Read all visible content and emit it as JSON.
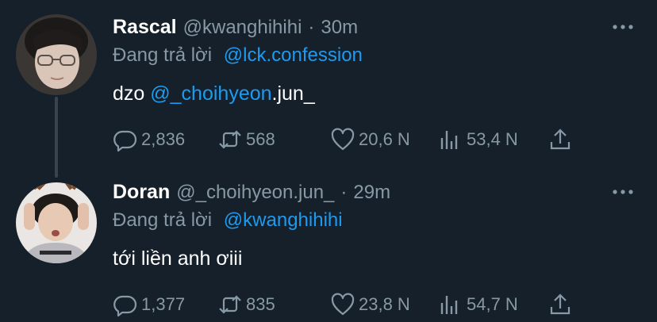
{
  "tweets": [
    {
      "display_name": "Rascal",
      "handle": "@kwanghihihi",
      "separator": "·",
      "time": "30m",
      "reply_prefix": "Đang trả lời",
      "reply_to": "@lck.confession",
      "body_prefix": "dzo ",
      "body_mention": "@_choihyeon",
      "body_suffix": ".jun_",
      "replies": "2,836",
      "retweets": "568",
      "likes": "20,6 N",
      "views": "53,4 N"
    },
    {
      "display_name": "Doran",
      "handle": "@_choihyeon.jun_",
      "separator": "·",
      "time": "29m",
      "reply_prefix": "Đang trả lời",
      "reply_to": "@kwanghihihi",
      "body_prefix": "tới liền anh ơiii",
      "body_mention": "",
      "body_suffix": "",
      "replies": "1,377",
      "retweets": "835",
      "likes": "23,8 N",
      "views": "54,7 N"
    }
  ],
  "colors": {
    "background": "#15202b",
    "text_primary": "#ffffff",
    "text_secondary": "#8899a6",
    "accent": "#1d9bf0",
    "thread_line": "#38444d"
  },
  "icons": [
    "reply-icon",
    "retweet-icon",
    "like-icon",
    "views-icon",
    "share-icon",
    "more-icon"
  ]
}
